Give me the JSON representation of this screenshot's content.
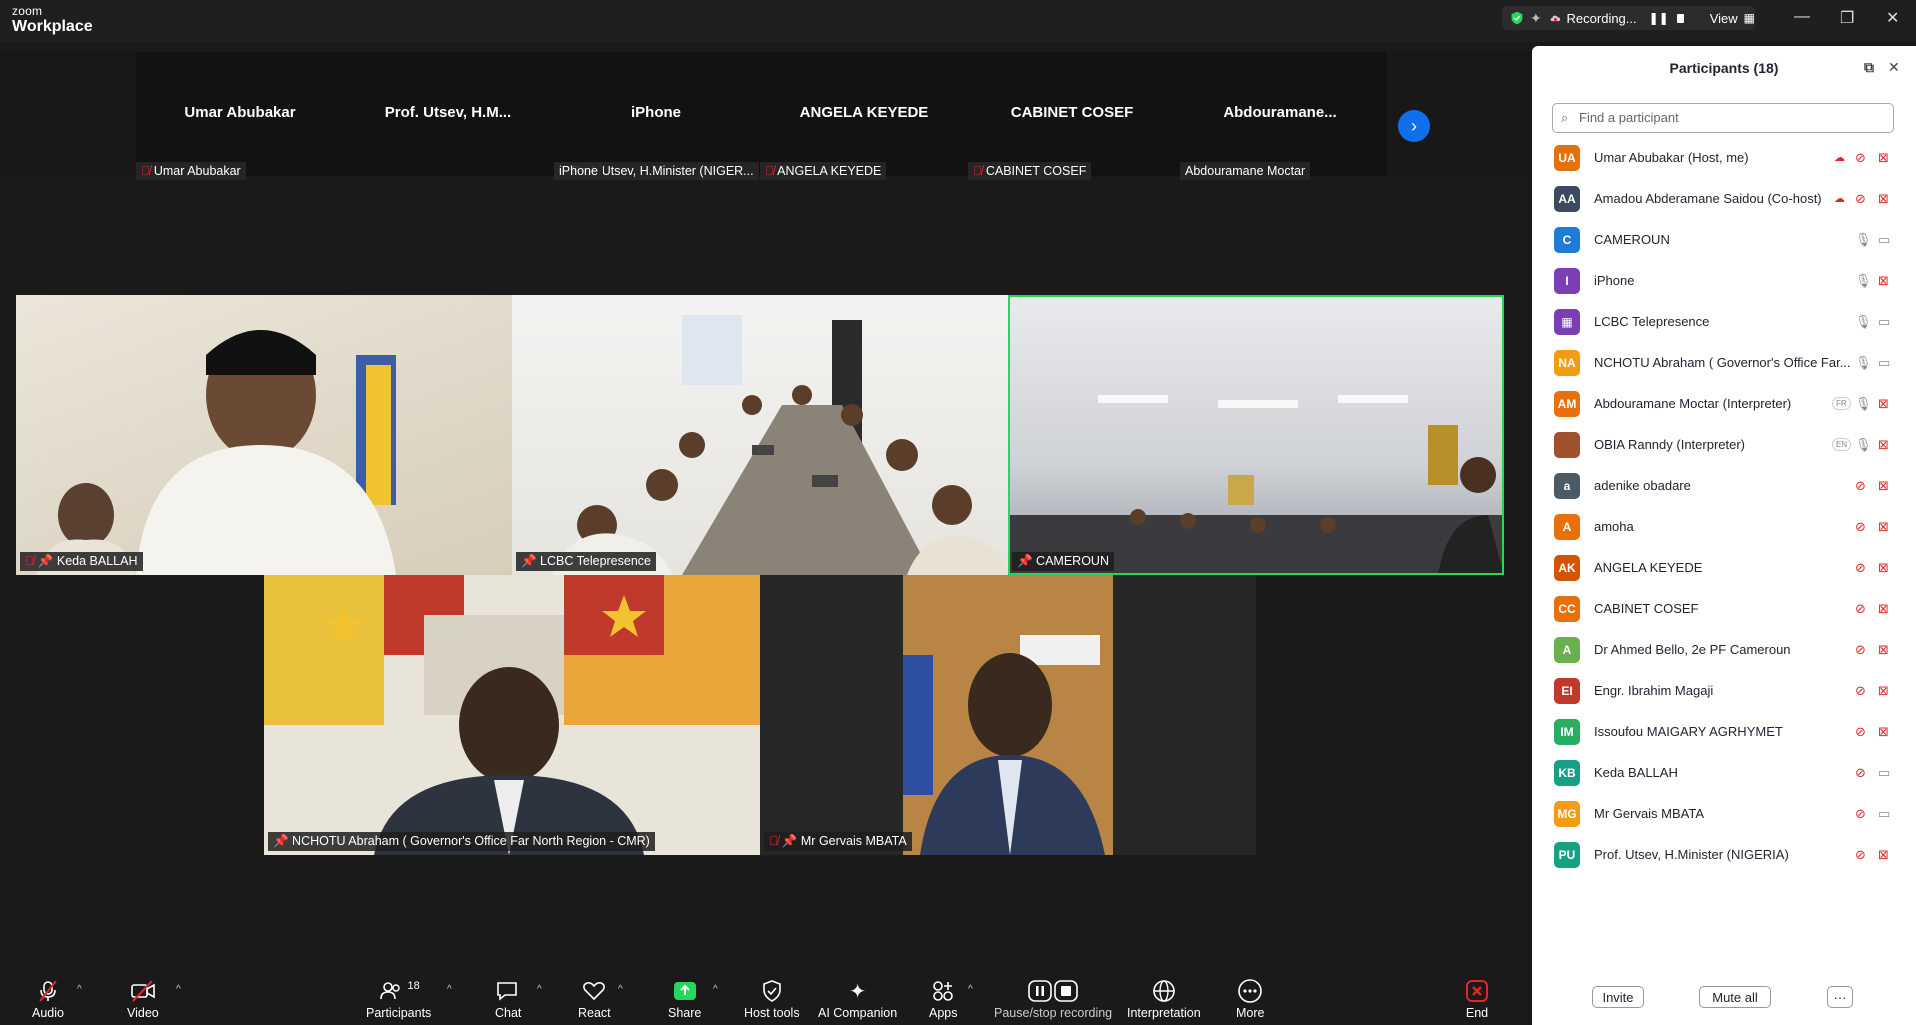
{
  "app": {
    "logo_line1": "zoom",
    "logo_line2": "Workplace"
  },
  "titlebar": {
    "recording_label": "Recording...",
    "view_label": "View",
    "minimize": "—",
    "restore": "❐",
    "close": "✕"
  },
  "strip": {
    "tiles": [
      {
        "name": "Umar Abubakar",
        "label": "Umar Abubakar"
      },
      {
        "name": "Prof.  Utsev,  H.M...",
        "label": "Prof. Utsev, H.Minister (NIGER..."
      },
      {
        "name": "iPhone",
        "label": "iPhone"
      },
      {
        "name": "ANGELA KEYEDE",
        "label": "ANGELA KEYEDE"
      },
      {
        "name": "CABINET COSEF",
        "label": "CABINET COSEF"
      },
      {
        "name": "Abdouramane...",
        "label": "Abdouramane Moctar"
      }
    ]
  },
  "gallery": {
    "tiles": [
      {
        "label": "Keda BALLAH"
      },
      {
        "label": "LCBC Telepresence"
      },
      {
        "label": "CAMEROUN"
      },
      {
        "label": "NCHOTU Abraham ( Governor's Office Far North Region - CMR)"
      },
      {
        "label": "Mr Gervais MBATA"
      }
    ]
  },
  "panel": {
    "title": "Participants (18)",
    "search_placeholder": "Find a participant",
    "participants": [
      {
        "initials": "UA",
        "name": "Umar Abubakar (Host, me)",
        "color": "#e8700a"
      },
      {
        "initials": "AA",
        "name": "Amadou Abderamane Saidou (Co-host)",
        "color": "#3b4a5e"
      },
      {
        "initials": "C",
        "name": "CAMEROUN",
        "color": "#1e7bd6"
      },
      {
        "initials": "I",
        "name": "iPhone",
        "color": "#7b3fb5"
      },
      {
        "initials": "▦",
        "name": "LCBC Telepresence",
        "color": "#7b3fb5"
      },
      {
        "initials": "NA",
        "name": "NCHOTU Abraham ( Governor's Office Far...",
        "color": "#f39c12"
      },
      {
        "initials": "AM",
        "name": "Abdouramane Moctar (Interpreter)",
        "color": "#e8700a"
      },
      {
        "initials": "",
        "name": "OBIA Ranndy (Interpreter)",
        "color": "#a0522d"
      },
      {
        "initials": "a",
        "name": "adenike obadare",
        "color": "#4a5a66"
      },
      {
        "initials": "A",
        "name": "amoha",
        "color": "#e8700a"
      },
      {
        "initials": "AK",
        "name": "ANGELA KEYEDE",
        "color": "#d35400"
      },
      {
        "initials": "CC",
        "name": "CABINET COSEF",
        "color": "#e8700a"
      },
      {
        "initials": "A",
        "name": "Dr Ahmed Bello, 2e PF Cameroun",
        "color": "#6ab04c"
      },
      {
        "initials": "EI",
        "name": "Engr. Ibrahim Magaji",
        "color": "#c0392b"
      },
      {
        "initials": "IM",
        "name": "Issoufou MAIGARY  AGRHYMET",
        "color": "#27ae60"
      },
      {
        "initials": "KB",
        "name": "Keda BALLAH",
        "color": "#16a085"
      },
      {
        "initials": "MG",
        "name": "Mr Gervais MBATA",
        "color": "#f39c12"
      },
      {
        "initials": "PU",
        "name": "Prof. Utsev, H.Minister (NIGERIA)",
        "color": "#16a085"
      }
    ],
    "badges": {
      "fr": "FR",
      "en": "EN"
    },
    "invite_label": "Invite",
    "mute_all_label": "Mute all",
    "more_label": "···"
  },
  "toolbar": {
    "audio": "Audio",
    "video": "Video",
    "participants": "Participants",
    "participants_count": "18",
    "chat": "Chat",
    "react": "React",
    "share": "Share",
    "host_tools": "Host tools",
    "ai_companion": "AI Companion",
    "apps": "Apps",
    "pause_stop": "Pause/stop recording",
    "interpretation": "Interpretation",
    "more": "More",
    "end": "End"
  }
}
